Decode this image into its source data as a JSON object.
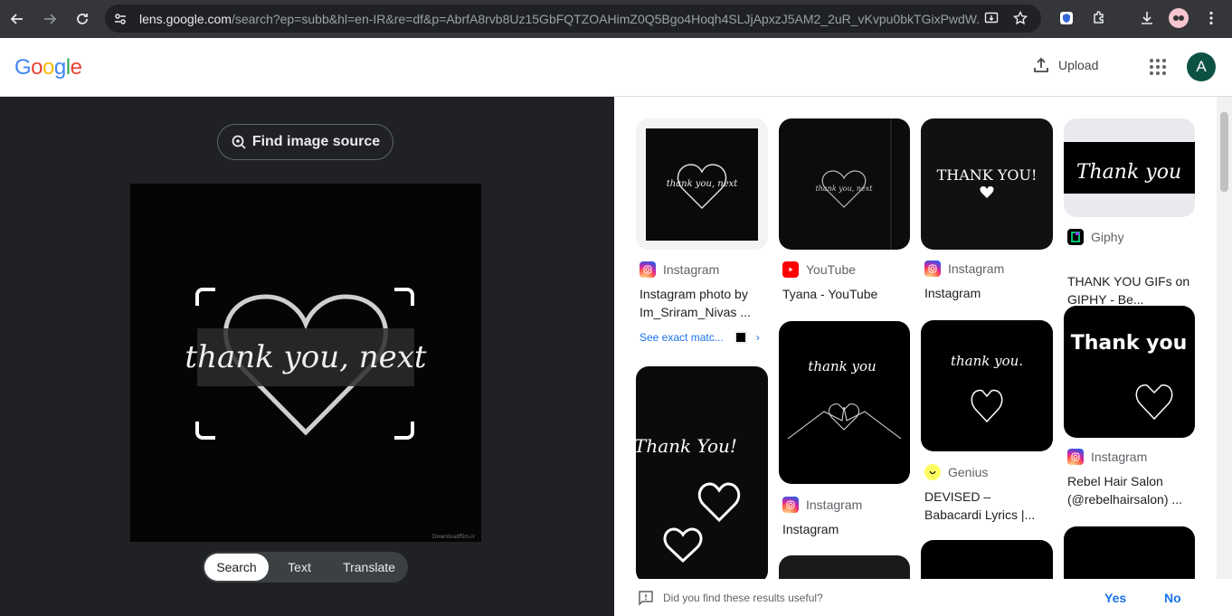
{
  "browser": {
    "url_host": "lens.google.com",
    "url_rest": "/search?ep=subb&hl=en-IR&re=df&p=AbrfA8rvb8Uz15GbFQTZOAHimZ0Q5Bgo4Hoqh4SLJjApxzJ5AM2_2uR_vKvpu0bkTGixPwdW..."
  },
  "header": {
    "logo": "Google",
    "upload_label": "Upload",
    "avatar_letter": "A"
  },
  "left": {
    "find_source_label": "Find image source",
    "preview_text": "thank you, next",
    "watermark": "Downloadfilm.ir",
    "tabs": [
      "Search",
      "Text",
      "Translate"
    ]
  },
  "results": [
    {
      "source": "Instagram",
      "title": "Instagram photo by Im_Sriram_Nivas ...",
      "exact": "See exact matc...",
      "thumb_text": "thank you, next"
    },
    {
      "source": "YouTube",
      "title": "Tyana - YouTube",
      "thumb_text": "thank you, next"
    },
    {
      "source": "Instagram",
      "title": "Instagram",
      "thumb_text": "THANK YOU!"
    },
    {
      "source": "Giphy",
      "title": "THANK YOU GIFs on GIPHY - Be...",
      "thumb_text": "Thank you"
    },
    {
      "source": "Instagram",
      "title": "Instagram",
      "thumb_text": "thank you"
    },
    {
      "source": "Genius",
      "title": "DEVISED – Babacardi Lyrics |...",
      "thumb_text": "thank you."
    },
    {
      "source": "Instagram",
      "title": "Rebel Hair Salon (@rebelhairsalon) ...",
      "thumb_text": "Thank you"
    },
    {
      "thumb_text": "Thank You!"
    }
  ],
  "feedback": {
    "question": "Did you find these results useful?",
    "yes": "Yes",
    "no": "No"
  },
  "colors": {
    "accent": "#1a73e8",
    "dark_bg": "#202124",
    "avatar": "#0b5244"
  }
}
